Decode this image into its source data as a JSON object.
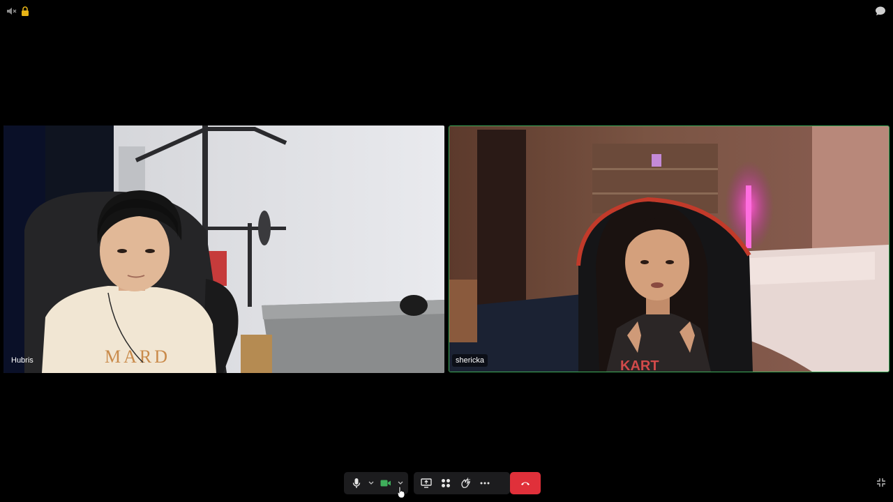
{
  "participants": [
    {
      "name": "Hubris"
    },
    {
      "name": "shericka"
    }
  ],
  "icons": {
    "top_left": [
      "speaker-muted-icon",
      "lock-icon"
    ],
    "top_right": "chat-bubble-icon",
    "toolbar": [
      "microphone-icon",
      "chevron-down-icon",
      "camera-icon",
      "chevron-down-icon",
      "share-screen-icon",
      "apps-grid-icon",
      "reactions-icon",
      "more-icon",
      "end-call-icon"
    ],
    "bottom_right": "exit-fullscreen-icon"
  },
  "colors": {
    "active_speaker": "#3fae5b",
    "end_call": "#e0303a",
    "camera_on": "#3fae5b"
  }
}
